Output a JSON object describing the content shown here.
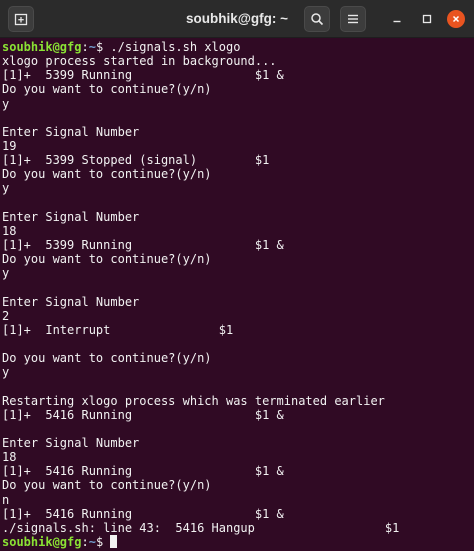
{
  "window": {
    "title": "soubhik@gfg: ~"
  },
  "icons": {
    "new_tab": "new-tab-icon",
    "search": "search-icon",
    "menu": "hamburger-menu-icon",
    "minimize": "minimize-icon",
    "maximize": "maximize-icon",
    "close": "close-icon"
  },
  "colors": {
    "terminal_bg": "#300a24",
    "titlebar_bg": "#2b2b2b",
    "prompt_user": "#8ae234",
    "prompt_path": "#729fcf",
    "text": "#f2f2f2",
    "close_button": "#e95420"
  },
  "terminal": {
    "prompt": {
      "user_host": "soubhik@gfg",
      "sep": ":",
      "path": "~",
      "symbol": "$ "
    },
    "command": "./signals.sh xlogo",
    "lines": [
      "xlogo process started in background...",
      "[1]+  5399 Running                 $1 &",
      "Do you want to continue?(y/n)",
      "y",
      "",
      "Enter Signal Number",
      "19",
      "[1]+  5399 Stopped (signal)        $1",
      "Do you want to continue?(y/n)",
      "y",
      "",
      "Enter Signal Number",
      "18",
      "[1]+  5399 Running                 $1 &",
      "Do you want to continue?(y/n)",
      "y",
      "",
      "Enter Signal Number",
      "2",
      "[1]+  Interrupt               $1",
      "",
      "Do you want to continue?(y/n)",
      "y",
      "",
      "Restarting xlogo process which was terminated earlier",
      "[1]+  5416 Running                 $1 &",
      "",
      "Enter Signal Number",
      "18",
      "[1]+  5416 Running                 $1 &",
      "Do you want to continue?(y/n)",
      "n",
      "[1]+  5416 Running                 $1 &",
      "./signals.sh: line 43:  5416 Hangup                  $1"
    ]
  }
}
